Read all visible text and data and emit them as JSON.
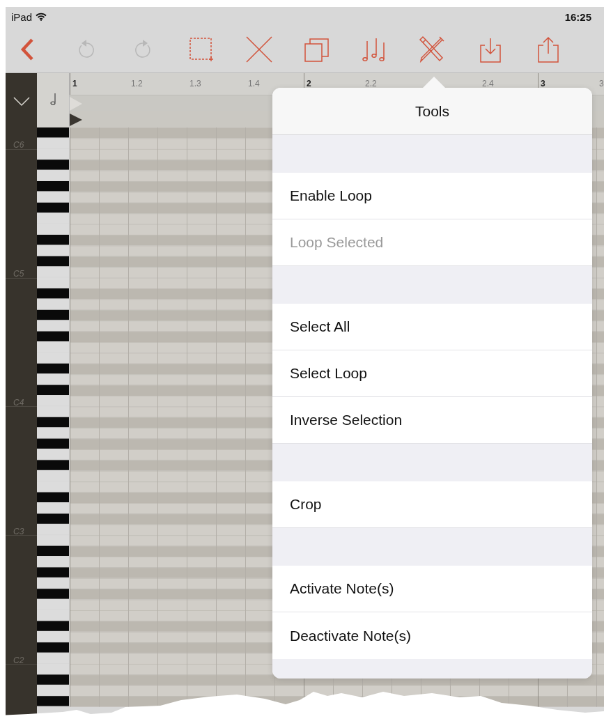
{
  "status_bar": {
    "device": "iPad",
    "time": "16:25"
  },
  "toolbar": [
    {
      "kind": "back",
      "disabled": false
    },
    {
      "kind": "undo",
      "disabled": true
    },
    {
      "kind": "redo",
      "disabled": true
    },
    {
      "kind": "select-box",
      "disabled": false
    },
    {
      "kind": "delete",
      "disabled": false
    },
    {
      "kind": "copy",
      "disabled": false
    },
    {
      "kind": "notes",
      "disabled": false
    },
    {
      "kind": "tools",
      "disabled": false
    },
    {
      "kind": "import",
      "disabled": false
    },
    {
      "kind": "share",
      "disabled": false
    }
  ],
  "ruler": [
    {
      "number": "1",
      "beat_2": "1.2",
      "beat_3": "1.3",
      "beat_4": "1.4"
    },
    {
      "number": "2",
      "beat_2": "2.2",
      "beat_4": "2.4"
    },
    {
      "number": "3",
      "beat_2": "3"
    }
  ],
  "octave_labels": [
    "C6",
    "C5",
    "C4",
    "C3",
    "C2"
  ],
  "popover": {
    "title": "Tools",
    "sections": [
      {
        "items": [
          {
            "label": "Enable Loop",
            "disabled": false
          },
          {
            "label": "Loop Selected",
            "disabled": true
          }
        ]
      },
      {
        "items": [
          {
            "label": "Select All",
            "disabled": false
          },
          {
            "label": "Select Loop",
            "disabled": false
          },
          {
            "label": "Inverse Selection",
            "disabled": false
          }
        ]
      },
      {
        "items": [
          {
            "label": "Crop",
            "disabled": false
          }
        ]
      },
      {
        "items": [
          {
            "label": "Activate Note(s)",
            "disabled": false
          },
          {
            "label": "Deactivate Note(s)",
            "disabled": false
          }
        ]
      }
    ]
  }
}
